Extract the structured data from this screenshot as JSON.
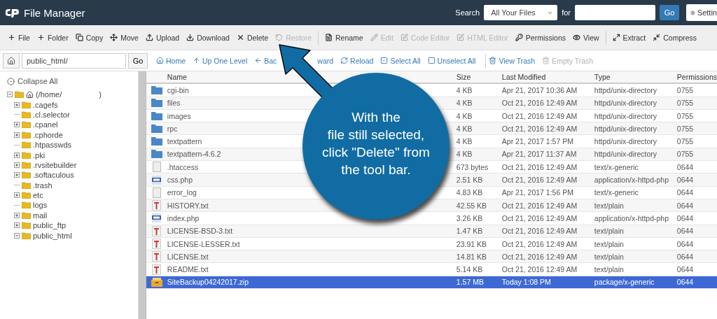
{
  "header": {
    "title": "File Manager",
    "search_label": "Search",
    "search_scope": "All Your Files",
    "for_label": "for",
    "go": "Go",
    "settings": "Settin"
  },
  "toolbar_groups": [
    [
      {
        "label": "File",
        "disabled": false
      },
      {
        "label": "Folder",
        "disabled": false
      },
      {
        "label": "Copy",
        "disabled": false
      },
      {
        "label": "Move",
        "disabled": false
      },
      {
        "label": "Upload",
        "disabled": false
      },
      {
        "label": "Download",
        "disabled": false
      },
      {
        "label": "Delete",
        "disabled": false
      },
      {
        "label": "Restore",
        "disabled": true
      }
    ],
    [
      {
        "label": "Rename",
        "disabled": false
      },
      {
        "label": "Edit",
        "disabled": true
      },
      {
        "label": "Code Editor",
        "disabled": true
      },
      {
        "label": "HTML Editor",
        "disabled": true
      },
      {
        "label": "Permissions",
        "disabled": false
      },
      {
        "label": "View",
        "disabled": false
      }
    ],
    [
      {
        "label": "Extract",
        "disabled": false
      },
      {
        "label": "Compress",
        "disabled": false
      }
    ]
  ],
  "path": {
    "value": "public_html/",
    "go": "Go"
  },
  "nav_groups": [
    [
      {
        "label": "Home",
        "disabled": false
      },
      {
        "label": "Up One Level",
        "disabled": false
      },
      {
        "label": "Bac",
        "disabled": false
      },
      {
        "label": "ward",
        "disabled": false
      },
      {
        "label": "Reload",
        "disabled": false
      },
      {
        "label": "Select All",
        "disabled": false
      },
      {
        "label": "Unselect All",
        "disabled": false
      }
    ],
    [
      {
        "label": "View Trash",
        "disabled": false
      },
      {
        "label": "Empty Trash",
        "disabled": true
      }
    ]
  ],
  "tree": {
    "collapse_all": "Collapse All",
    "root": {
      "label": "(/home/",
      "label_end": ")",
      "expanded": true,
      "children": [
        {
          "label": ".cagefs",
          "expanded": false
        },
        {
          "label": ".cl.selector"
        },
        {
          "label": ".cpanel",
          "expanded": false
        },
        {
          "label": ".cphorde",
          "expanded": false
        },
        {
          "label": ".htpasswds"
        },
        {
          "label": ".pki",
          "expanded": false
        },
        {
          "label": ".rvsitebuilder",
          "expanded": false
        },
        {
          "label": ".softaculous",
          "expanded": false
        },
        {
          "label": ".trash"
        },
        {
          "label": "etc",
          "expanded": false
        },
        {
          "label": "logs"
        },
        {
          "label": "mail",
          "expanded": false
        },
        {
          "label": "public_ftp",
          "expanded": false
        },
        {
          "label": "public_html",
          "expanded": true
        }
      ]
    }
  },
  "table": {
    "columns": [
      "Name",
      "Size",
      "Last Modified",
      "Type",
      "Permissions"
    ],
    "rows": [
      {
        "kind": "folder",
        "name": "cgi-bin",
        "size": "4 KB",
        "modified": "Apr 21, 2017 10:36 AM",
        "type": "httpd/unix-directory",
        "perms": "0755",
        "selected": false
      },
      {
        "kind": "folder",
        "name": "files",
        "size": "4 KB",
        "modified": "Oct 21, 2016 12:49 AM",
        "type": "httpd/unix-directory",
        "perms": "0755",
        "selected": false
      },
      {
        "kind": "folder",
        "name": "images",
        "size": "4 KB",
        "modified": "Oct 21, 2016 12:49 AM",
        "type": "httpd/unix-directory",
        "perms": "0755",
        "selected": false
      },
      {
        "kind": "folder",
        "name": "rpc",
        "size": "4 KB",
        "modified": "Oct 21, 2016 12:49 AM",
        "type": "httpd/unix-directory",
        "perms": "0755",
        "selected": false
      },
      {
        "kind": "folder",
        "name": "textpattern",
        "size": "4 KB",
        "modified": "Apr 21, 2017 1:57 PM",
        "type": "httpd/unix-directory",
        "perms": "0755",
        "selected": false
      },
      {
        "kind": "folder",
        "name": "textpattern-4.6.2",
        "size": "4 KB",
        "modified": "Apr 21, 2017 11:37 AM",
        "type": "httpd/unix-directory",
        "perms": "0755",
        "selected": false
      },
      {
        "kind": "generic",
        "name": ".htaccess",
        "size": "673 bytes",
        "modified": "Oct 21, 2016 12:49 AM",
        "type": "text/x-generic",
        "perms": "0644",
        "selected": false
      },
      {
        "kind": "php",
        "name": "css.php",
        "size": "2.51 KB",
        "modified": "Oct 21, 2016 12:49 AM",
        "type": "application/x-httpd-php",
        "perms": "0644",
        "selected": false
      },
      {
        "kind": "generic",
        "name": "error_log",
        "size": "4.83 KB",
        "modified": "Apr 21, 2017 1:56 PM",
        "type": "text/x-generic",
        "perms": "0644",
        "selected": false
      },
      {
        "kind": "text",
        "name": "HISTORY.txt",
        "size": "42.55 KB",
        "modified": "Oct 21, 2016 12:49 AM",
        "type": "text/plain",
        "perms": "0644",
        "selected": false
      },
      {
        "kind": "php",
        "name": "index.php",
        "size": "3.26 KB",
        "modified": "Oct 21, 2016 12:49 AM",
        "type": "application/x-httpd-php",
        "perms": "0644",
        "selected": false
      },
      {
        "kind": "text",
        "name": "LICENSE-BSD-3.txt",
        "size": "1.47 KB",
        "modified": "Oct 21, 2016 12:49 AM",
        "type": "text/plain",
        "perms": "0644",
        "selected": false
      },
      {
        "kind": "text",
        "name": "LICENSE-LESSER.txt",
        "size": "23.91 KB",
        "modified": "Oct 21, 2016 12:49 AM",
        "type": "text/plain",
        "perms": "0644",
        "selected": false
      },
      {
        "kind": "text",
        "name": "LICENSE.txt",
        "size": "14.81 KB",
        "modified": "Oct 21, 2016 12:49 AM",
        "type": "text/plain",
        "perms": "0644",
        "selected": false
      },
      {
        "kind": "text",
        "name": "README.txt",
        "size": "5.14 KB",
        "modified": "Oct 21, 2016 12:49 AM",
        "type": "text/plain",
        "perms": "0644",
        "selected": false
      },
      {
        "kind": "archive",
        "name": "SiteBackup04242017.zip",
        "size": "1.57 MB",
        "modified": "Today 1:08 PM",
        "type": "package/x-generic",
        "perms": "0644",
        "selected": true
      }
    ]
  },
  "callout": {
    "text": "With the\nfile still selected,\nclick \"Delete\" from\nthe tool bar."
  }
}
